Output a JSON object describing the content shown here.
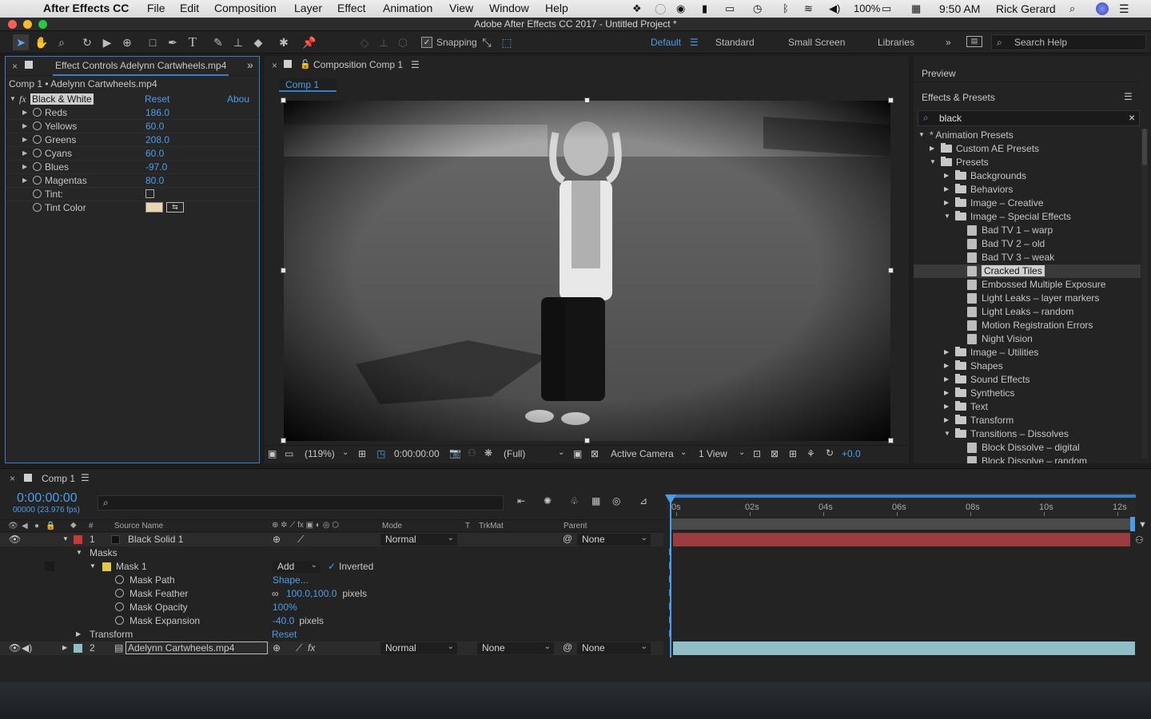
{
  "menubar": {
    "app_name": "After Effects CC",
    "menus": [
      "File",
      "Edit",
      "Composition",
      "Layer",
      "Effect",
      "Animation",
      "View",
      "Window",
      "Help"
    ],
    "battery": "100%",
    "time": "9:50 AM",
    "user": "Rick Gerard"
  },
  "window": {
    "title": "Adobe After Effects CC 2017 - Untitled Project *"
  },
  "toolbar": {
    "snapping_label": "Snapping",
    "workspaces": [
      "Default",
      "Standard",
      "Small Screen",
      "Libraries"
    ],
    "active_workspace": "Default",
    "search_placeholder": "Search Help"
  },
  "effect_controls": {
    "tab_prefix": "Effect Controls",
    "tab_file": "Adelynn Cartwheels.mp4",
    "breadcrumb": "Comp 1 • Adelynn Cartwheels.mp4",
    "effect_name": "Black & White",
    "reset_label": "Reset",
    "about_label": "Abou",
    "fx_label": "fx",
    "props": [
      {
        "label": "Reds",
        "value": "186.0"
      },
      {
        "label": "Yellows",
        "value": "60.0"
      },
      {
        "label": "Greens",
        "value": "208.0"
      },
      {
        "label": "Cyans",
        "value": "60.0"
      },
      {
        "label": "Blues",
        "value": "-97.0"
      },
      {
        "label": "Magentas",
        "value": "80.0"
      },
      {
        "label": "Tint:",
        "value": ""
      },
      {
        "label": "Tint Color",
        "value": ""
      }
    ],
    "tint_color": "#e9d6ae"
  },
  "composition": {
    "tab_prefix": "Composition",
    "tab_name": "Comp 1",
    "flowchart_tab": "Comp 1",
    "zoom": "(119%)",
    "timecode": "0:00:00:00",
    "resolution": "(Full)",
    "camera": "Active Camera",
    "views": "1 View",
    "exposure": "+0.0"
  },
  "right_panel": {
    "preview_title": "Preview",
    "effects_title": "Effects & Presets",
    "search_value": "black",
    "tree": [
      {
        "label": "* Animation Presets",
        "level": 0,
        "kind": "root",
        "open": true
      },
      {
        "label": "Custom AE Presets",
        "level": 1,
        "kind": "folder",
        "open": false
      },
      {
        "label": "Presets",
        "level": 1,
        "kind": "folder",
        "open": true
      },
      {
        "label": "Backgrounds",
        "level": 2,
        "kind": "folder",
        "open": false
      },
      {
        "label": "Behaviors",
        "level": 2,
        "kind": "folder",
        "open": false
      },
      {
        "label": "Image – Creative",
        "level": 2,
        "kind": "folder",
        "open": false
      },
      {
        "label": "Image – Special Effects",
        "level": 2,
        "kind": "folder",
        "open": true
      },
      {
        "label": "Bad TV 1 – warp",
        "level": 3,
        "kind": "preset"
      },
      {
        "label": "Bad TV 2 – old",
        "level": 3,
        "kind": "preset"
      },
      {
        "label": "Bad TV 3 – weak",
        "level": 3,
        "kind": "preset"
      },
      {
        "label": "Cracked Tiles",
        "level": 3,
        "kind": "preset",
        "selected": true
      },
      {
        "label": "Embossed Multiple Exposure",
        "level": 3,
        "kind": "preset"
      },
      {
        "label": "Light Leaks – layer markers",
        "level": 3,
        "kind": "preset"
      },
      {
        "label": "Light Leaks – random",
        "level": 3,
        "kind": "preset"
      },
      {
        "label": "Motion Registration Errors",
        "level": 3,
        "kind": "preset"
      },
      {
        "label": "Night Vision",
        "level": 3,
        "kind": "preset"
      },
      {
        "label": "Image – Utilities",
        "level": 2,
        "kind": "folder",
        "open": false
      },
      {
        "label": "Shapes",
        "level": 2,
        "kind": "folder",
        "open": false
      },
      {
        "label": "Sound Effects",
        "level": 2,
        "kind": "folder",
        "open": false
      },
      {
        "label": "Synthetics",
        "level": 2,
        "kind": "folder",
        "open": false
      },
      {
        "label": "Text",
        "level": 2,
        "kind": "folder",
        "open": false
      },
      {
        "label": "Transform",
        "level": 2,
        "kind": "folder",
        "open": false
      },
      {
        "label": "Transitions – Dissolves",
        "level": 2,
        "kind": "folder",
        "open": true
      },
      {
        "label": "Block Dissolve – digital",
        "level": 3,
        "kind": "preset"
      },
      {
        "label": "Block Dissolve – random",
        "level": 3,
        "kind": "preset"
      }
    ]
  },
  "timeline": {
    "tab_name": "Comp 1",
    "timecode": "0:00:00:00",
    "frame_info": "00000 (23.976 fps)",
    "headers": {
      "hash": "#",
      "source": "Source Name",
      "mode": "Mode",
      "t": "T",
      "trkmat": "TrkMat",
      "parent": "Parent"
    },
    "layer1": {
      "index": "1",
      "name": "Black Solid 1",
      "mode": "Normal",
      "parent": "None",
      "color": "#c8393a"
    },
    "masks_label": "Masks",
    "mask1": {
      "name": "Mask 1",
      "mode": "Add",
      "inverted_label": "Inverted",
      "color": "#e0c84a"
    },
    "mask_props": [
      {
        "label": "Mask Path",
        "value": "Shape...",
        "unit": ""
      },
      {
        "label": "Mask Feather",
        "value": "100.0,100.0",
        "unit": " pixels"
      },
      {
        "label": "Mask Opacity",
        "value": "100%",
        "unit": ""
      },
      {
        "label": "Mask Expansion",
        "value": "-40.0",
        "unit": " pixels"
      }
    ],
    "transform_label": "Transform",
    "transform_reset": "Reset",
    "layer2": {
      "index": "2",
      "name": "Adelynn Cartwheels.mp4",
      "mode": "Normal",
      "trkmat": "None",
      "parent": "None",
      "color": "#8fbfc6"
    },
    "ruler": [
      "0s",
      "02s",
      "04s",
      "06s",
      "08s",
      "10s",
      "12s"
    ]
  }
}
